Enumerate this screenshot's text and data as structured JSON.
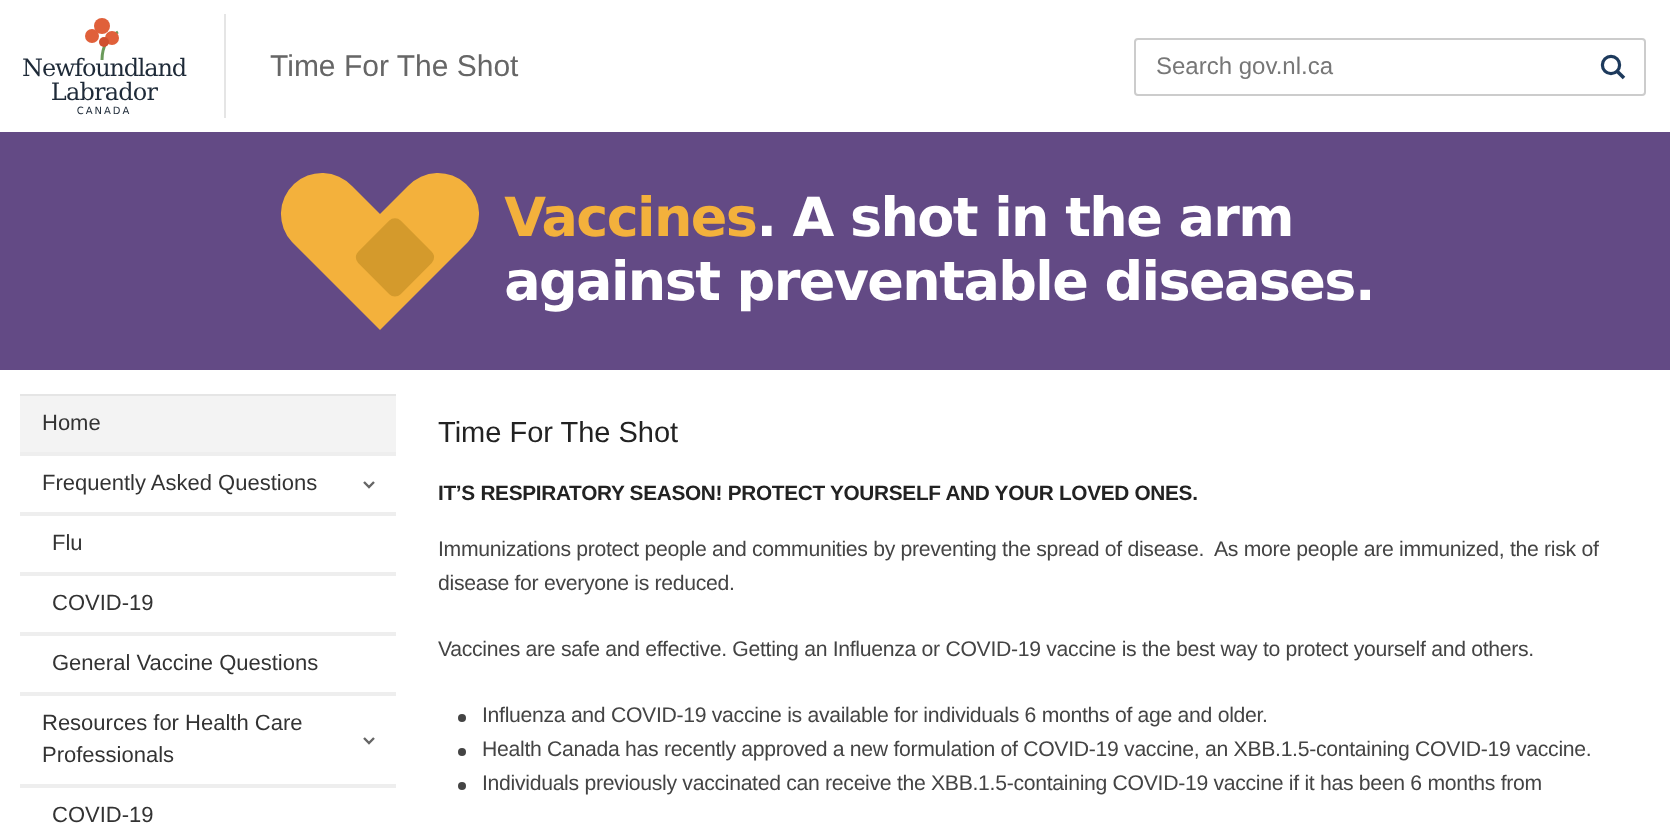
{
  "header": {
    "logo": {
      "line1": "Newfoundland",
      "line2": "Labrador",
      "line3": "CANADA"
    },
    "site_title": "Time For The Shot",
    "search": {
      "placeholder": "Search gov.nl.ca"
    }
  },
  "banner": {
    "highlight": "Vaccines",
    "text_line1": ". A shot in the arm",
    "text_line2": "against preventable diseases."
  },
  "sidebar": {
    "items": [
      {
        "label": "Home",
        "selected": true
      },
      {
        "label": "Frequently Asked Questions",
        "selected": false,
        "expanded": true,
        "children": [
          {
            "label": "Flu",
            "selected": false
          },
          {
            "label": "COVID-19",
            "selected": false
          },
          {
            "label": "General Vaccine Questions",
            "selected": false
          }
        ]
      },
      {
        "label": "Resources for Health Care Professionals",
        "selected": false,
        "expanded": true,
        "children": [
          {
            "label": "COVID-19",
            "selected": false
          }
        ]
      }
    ]
  },
  "content": {
    "title": "Time For The Shot",
    "subtitle": "IT’S RESPIRATORY SEASON! PROTECT YOURSELF AND YOUR LOVED ONES.",
    "paragraphs": [
      "Immunizations protect people and communities by preventing the spread of disease.  As more people are immunized, the risk of disease for everyone is reduced.",
      "Vaccines are safe and effective. Getting an Influenza or COVID-19 vaccine is the best way to protect yourself and others."
    ],
    "bullets": [
      "Influenza and COVID-19 vaccine is available for individuals 6 months of age and older.",
      "Health Canada has recently approved a new formulation of COVID-19 vaccine, an XBB.1.5-containing COVID-19 vaccine.",
      "Individuals previously vaccinated can receive the XBB.1.5-containing COVID-19 vaccine if it has been 6 months from"
    ]
  }
}
